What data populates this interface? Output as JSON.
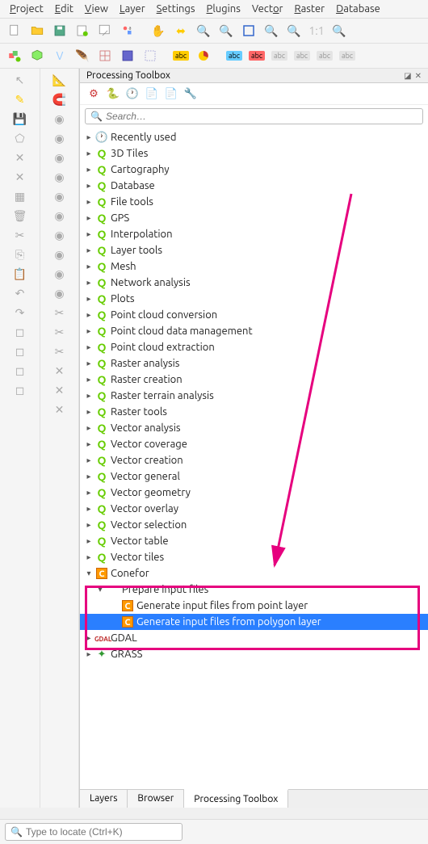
{
  "menu": {
    "project": "Project",
    "edit": "Edit",
    "view": "View",
    "layer": "Layer",
    "settings": "Settings",
    "plugins": "Plugins",
    "vector": "Vector",
    "raster": "Raster",
    "database": "Database"
  },
  "panel": {
    "title": "Processing Toolbox"
  },
  "search": {
    "placeholder": "Search…"
  },
  "tree": {
    "recent": "Recently used",
    "categories": [
      "3D Tiles",
      "Cartography",
      "Database",
      "File tools",
      "GPS",
      "Interpolation",
      "Layer tools",
      "Mesh",
      "Network analysis",
      "Plots",
      "Point cloud conversion",
      "Point cloud data management",
      "Point cloud extraction",
      "Raster analysis",
      "Raster creation",
      "Raster terrain analysis",
      "Raster tools",
      "Vector analysis",
      "Vector coverage",
      "Vector creation",
      "Vector general",
      "Vector geometry",
      "Vector overlay",
      "Vector selection",
      "Vector table",
      "Vector tiles"
    ],
    "conefor": {
      "label": "Conefor",
      "sub": "Prepare input files",
      "item1": "Generate input files from point layer",
      "item2": "Generate input files from polygon layer"
    },
    "gdal": "GDAL",
    "grass": "GRASS"
  },
  "tabs": {
    "layers": "Layers",
    "browser": "Browser",
    "toolbox": "Processing Toolbox"
  },
  "locator": {
    "placeholder": "Type to locate (Ctrl+K)"
  }
}
